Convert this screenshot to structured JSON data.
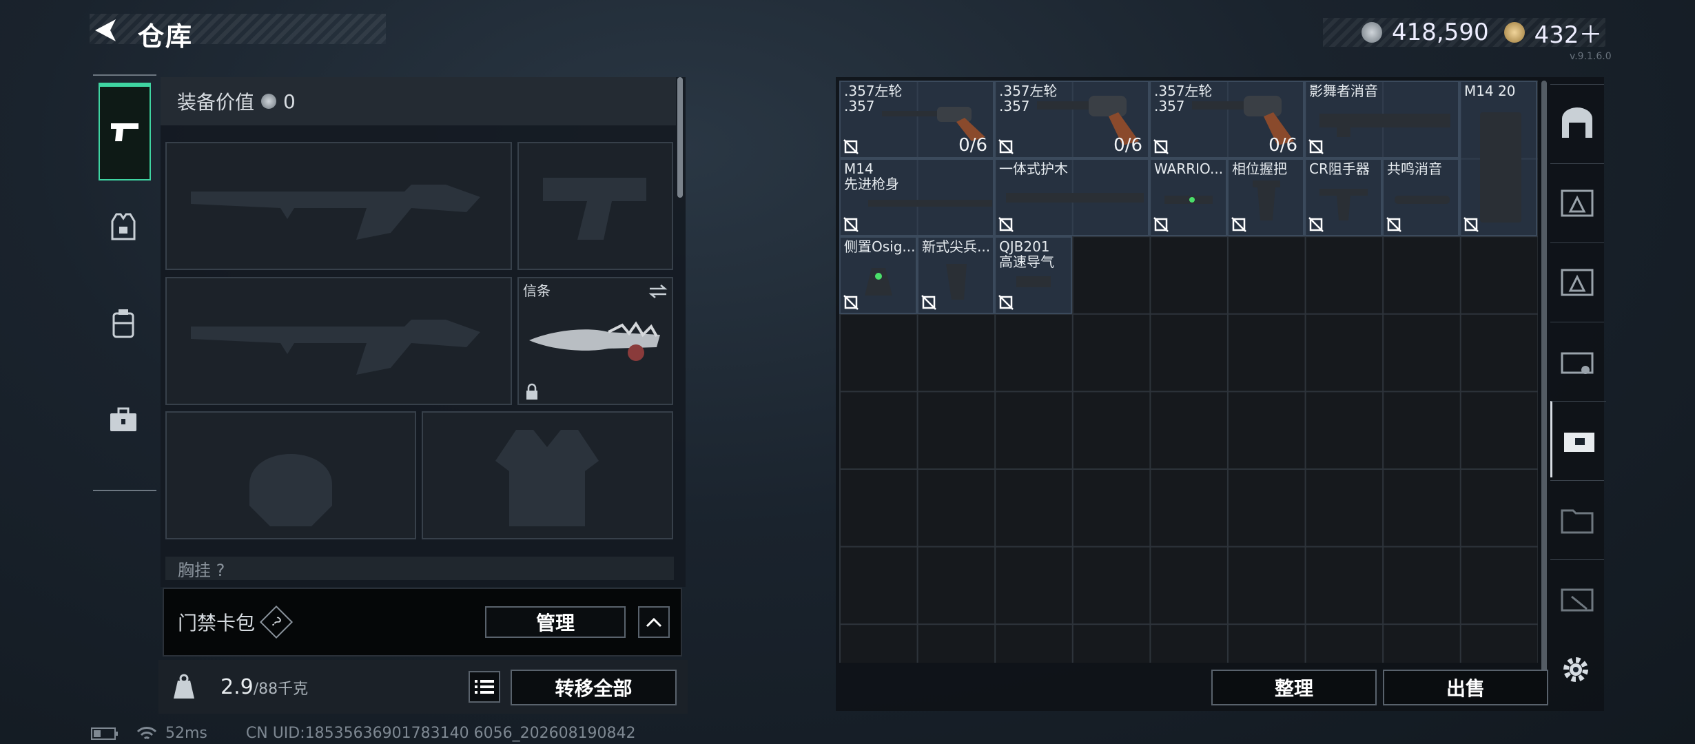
{
  "header": {
    "title": "仓库"
  },
  "currency": {
    "silver": "418,590",
    "gold": "432＋"
  },
  "version": "v.9.1.6.0",
  "equipment": {
    "value_label": "装备价值",
    "value": "0",
    "melee_slot_label": "信条",
    "chest_label": "胸挂 ?"
  },
  "cardbag": {
    "label": "门禁卡包",
    "help": "?",
    "manage_button": "管理"
  },
  "weight": {
    "current": "2.9",
    "max": "/88千克"
  },
  "transfer_button": "转移全部",
  "storage": {
    "items": [
      {
        "name": ".357左轮\n.357",
        "count": "0/6"
      },
      {
        "name": ".357左轮\n.357",
        "count": "0/6"
      },
      {
        "name": ".357左轮\n.357",
        "count": "0/6"
      },
      {
        "name": "影舞者消音",
        "count": ""
      },
      {
        "name": "M14 20",
        "count": ""
      },
      {
        "name": "M14\n先进枪身",
        "count": ""
      },
      {
        "name": "一体式护木",
        "count": ""
      },
      {
        "name": "WARRIO...",
        "count": ""
      },
      {
        "name": "相位握把",
        "count": ""
      },
      {
        "name": "CR阻手器",
        "count": ""
      },
      {
        "name": "共鸣消音",
        "count": ""
      },
      {
        "name": "侧置Osig...",
        "count": ""
      },
      {
        "name": "新式尖兵...",
        "count": ""
      },
      {
        "name": "QJB201\n高速导气",
        "count": ""
      }
    ],
    "sort_button": "整理",
    "sell_button": "出售"
  },
  "status": {
    "ping": "52ms",
    "uid": "CN UID:18535636901783140 6056_202608190842"
  },
  "colors": {
    "accent": "#3fd5a2",
    "item_bg": "#34465c"
  },
  "icons": [
    "back-arrow-icon",
    "pistol-tab-icon",
    "vest-tab-icon",
    "backpack-tab-icon",
    "toolbox-tab-icon",
    "list-icon",
    "weight-icon",
    "settings-icon"
  ]
}
